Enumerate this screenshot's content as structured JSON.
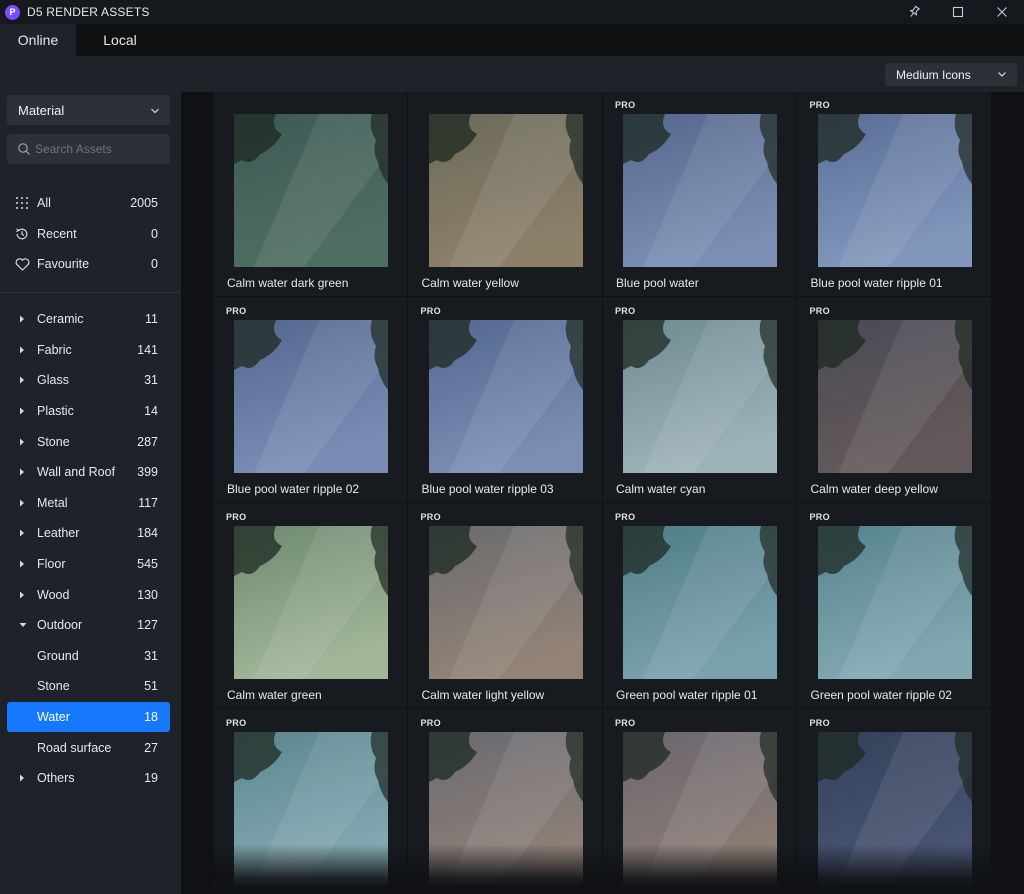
{
  "app": {
    "title": "D5 RENDER ASSETS",
    "logo_letter": "P"
  },
  "tabs": [
    {
      "label": "Online",
      "active": true
    },
    {
      "label": "Local",
      "active": false
    }
  ],
  "view_mode": {
    "selected": "Medium Icons"
  },
  "sidebar": {
    "type_dropdown": "Material",
    "search_placeholder": "Search Assets",
    "quick": [
      {
        "label": "All",
        "count": "2005",
        "icon": "grid-dots-icon"
      },
      {
        "label": "Recent",
        "count": "0",
        "icon": "history-icon"
      },
      {
        "label": "Favourite",
        "count": "0",
        "icon": "heart-icon"
      }
    ],
    "categories": [
      {
        "label": "Ceramic",
        "count": "11",
        "expanded": false
      },
      {
        "label": "Fabric",
        "count": "141",
        "expanded": false
      },
      {
        "label": "Glass",
        "count": "31",
        "expanded": false
      },
      {
        "label": "Plastic",
        "count": "14",
        "expanded": false
      },
      {
        "label": "Stone",
        "count": "287",
        "expanded": false
      },
      {
        "label": "Wall and Roof",
        "count": "399",
        "expanded": false
      },
      {
        "label": "Metal",
        "count": "117",
        "expanded": false
      },
      {
        "label": "Leather",
        "count": "184",
        "expanded": false
      },
      {
        "label": "Floor",
        "count": "545",
        "expanded": false
      },
      {
        "label": "Wood",
        "count": "130",
        "expanded": false
      },
      {
        "label": "Outdoor",
        "count": "127",
        "expanded": true,
        "children": [
          {
            "label": "Ground",
            "count": "31",
            "selected": false
          },
          {
            "label": "Stone",
            "count": "51",
            "selected": false
          },
          {
            "label": "Water",
            "count": "18",
            "selected": true
          },
          {
            "label": "Road surface",
            "count": "27",
            "selected": false
          }
        ]
      },
      {
        "label": "Others",
        "count": "19",
        "expanded": false
      }
    ]
  },
  "assets": [
    {
      "name": "Calm water dark green",
      "pro": false,
      "color_top": "#3d5a55",
      "color_bottom": "#4f6e62"
    },
    {
      "name": "Calm water yellow",
      "pro": false,
      "color_top": "#6b6a5a",
      "color_bottom": "#8d8069"
    },
    {
      "name": "Blue pool water",
      "pro": true,
      "color_top": "#55678c",
      "color_bottom": "#7b8fb4"
    },
    {
      "name": "Blue pool water ripple 01",
      "pro": true,
      "color_top": "#5a6e95",
      "color_bottom": "#8197bc"
    },
    {
      "name": "Blue pool water ripple 02",
      "pro": true,
      "color_top": "#54688f",
      "color_bottom": "#7a8eb5"
    },
    {
      "name": "Blue pool water ripple 03",
      "pro": true,
      "color_top": "#54688f",
      "color_bottom": "#7b8fb5"
    },
    {
      "name": "Calm water cyan",
      "pro": true,
      "color_top": "#6f8a92",
      "color_bottom": "#9db3b8"
    },
    {
      "name": "Calm water deep yellow",
      "pro": true,
      "color_top": "#4a4a55",
      "color_bottom": "#63595a"
    },
    {
      "name": "Calm water green",
      "pro": true,
      "color_top": "#6d8a70",
      "color_bottom": "#a2b698"
    },
    {
      "name": "Calm water light yellow",
      "pro": true,
      "color_top": "#6a6b6e",
      "color_bottom": "#928376"
    },
    {
      "name": "Green pool water ripple 01",
      "pro": true,
      "color_top": "#4f7c88",
      "color_bottom": "#7aa2ae"
    },
    {
      "name": "Green pool water ripple 02",
      "pro": true,
      "color_top": "#56838e",
      "color_bottom": "#82a8b2"
    },
    {
      "name": "",
      "pro": true,
      "color_top": "#5b8790",
      "color_bottom": "#86aab2"
    },
    {
      "name": "",
      "pro": true,
      "color_top": "#6a6a72",
      "color_bottom": "#8f8177"
    },
    {
      "name": "",
      "pro": true,
      "color_top": "#6a6670",
      "color_bottom": "#8d7e74"
    },
    {
      "name": "",
      "pro": true,
      "color_top": "#33415a",
      "color_bottom": "#4a5674"
    }
  ],
  "pro_label": "PRO",
  "colors": {
    "accent": "#1677ff",
    "sidebar_bg": "#1f2329",
    "grid_bg": "#171a1f"
  }
}
